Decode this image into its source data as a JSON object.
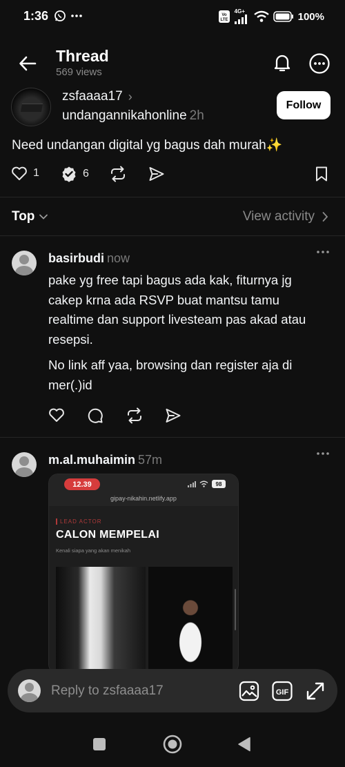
{
  "status_bar": {
    "time": "1:36",
    "battery": "100%",
    "network": "4G+"
  },
  "header": {
    "title": "Thread",
    "views": "569 views"
  },
  "post": {
    "author": "zsfaaaa17",
    "coauthor": "undangannikahonline",
    "time": "2h",
    "follow_label": "Follow",
    "text": "Need undangan digital yg bagus dah murah✨",
    "likes": "1",
    "reposts": "6"
  },
  "sort": {
    "label": "Top",
    "view_activity": "View activity"
  },
  "replies": [
    {
      "user": "basirbudi",
      "time": "now",
      "paragraphs": [
        "pake yg free tapi bagus ada kak, fiturnya jg cakep krna ada RSVP buat mantsu tamu realtime dan support livesteam pas akad atau resepsi.",
        "No link aff yaa, browsing dan register aja di mer(.)id"
      ]
    },
    {
      "user": "m.al.muhaimin",
      "time": "57m",
      "embed": {
        "time": "12.39",
        "battery": "98",
        "url": "gipay-nikahin.netlify.app",
        "kicker": "LEAD ACTOR",
        "headline": "CALON MEMPELAI",
        "subtitle": "Kenali siapa yang akan menikah"
      }
    }
  ],
  "reply_bar": {
    "placeholder": "Reply to zsfaaaa17"
  },
  "colors": {
    "background": "#101010",
    "muted": "#8a8a8a",
    "accent_red": "#d63c3c"
  }
}
